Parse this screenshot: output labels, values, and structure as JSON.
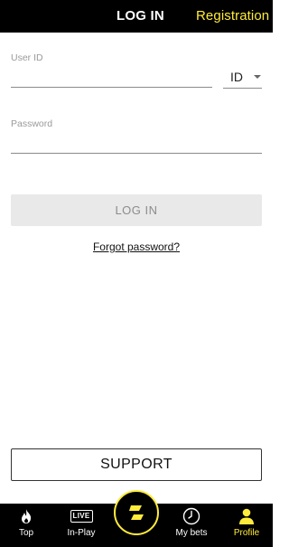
{
  "colors": {
    "accent": "#ffeb3b",
    "header_bg": "#000000",
    "nav_bg": "#000000"
  },
  "header": {
    "title": "LOG IN",
    "registration_label": "Registration"
  },
  "form": {
    "user_id": {
      "label": "User ID",
      "value": ""
    },
    "id_type": {
      "selected": "ID"
    },
    "password": {
      "label": "Password",
      "value": ""
    },
    "login_label": "LOG IN",
    "forgot_label": "Forgot password?"
  },
  "support_label": "SUPPORT",
  "bottom_nav": {
    "items": [
      {
        "label": "Top",
        "icon": "flame-icon"
      },
      {
        "label": "In-Play",
        "icon": "live-icon",
        "badge": "LIVE"
      },
      {
        "label": "",
        "icon": "logo-icon"
      },
      {
        "label": "My bets",
        "icon": "clock-icon"
      },
      {
        "label": "Profile",
        "icon": "user-icon",
        "active": true
      }
    ]
  }
}
